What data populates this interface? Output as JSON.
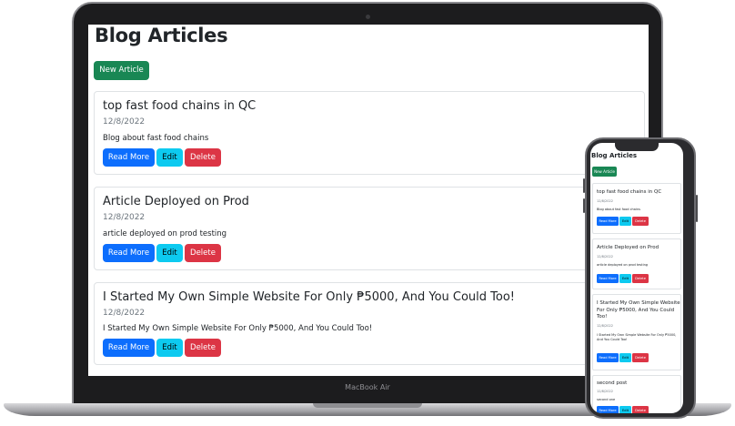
{
  "laptop": {
    "brand": "MacBook Air"
  },
  "page": {
    "title": "Blog Articles",
    "new_article_label": "New Article"
  },
  "articles": [
    {
      "title": "top fast food chains in QC",
      "date": "12/8/2022",
      "text": "Blog about fast food chains"
    },
    {
      "title": "Article Deployed on Prod",
      "date": "12/8/2022",
      "text": "article deployed on prod testing"
    },
    {
      "title": "I Started My Own Simple Website For Only ₱5000, And You Could Too!",
      "date": "12/8/2022",
      "text": "I Started My Own Simple Website For Only ₱5000, And You Could Too!"
    }
  ],
  "buttons": {
    "read_more": "Read More",
    "edit": "Edit",
    "delete": "Delete"
  },
  "mobile": {
    "title": "Blog Articles",
    "new_article_label": "New Article",
    "articles": [
      {
        "title": "top fast food chains in QC",
        "date": "12/8/2022",
        "text": "Blog about fast food chains"
      },
      {
        "title": "Article Deployed on Prod",
        "date": "12/8/2022",
        "text": "article deployed on prod testing"
      },
      {
        "title": "I Started My Own Simple Website For Only ₱5000, And You Could Too!",
        "date": "12/8/2022",
        "text": "I Started My Own Simple Website For Only ₱5000, And You Could Too!"
      },
      {
        "title": "second post",
        "date": "12/8/2022",
        "text": "second one"
      }
    ]
  },
  "colors": {
    "success": "#198754",
    "primary": "#0d6efd",
    "info": "#0dcaf0",
    "danger": "#dc3545"
  }
}
